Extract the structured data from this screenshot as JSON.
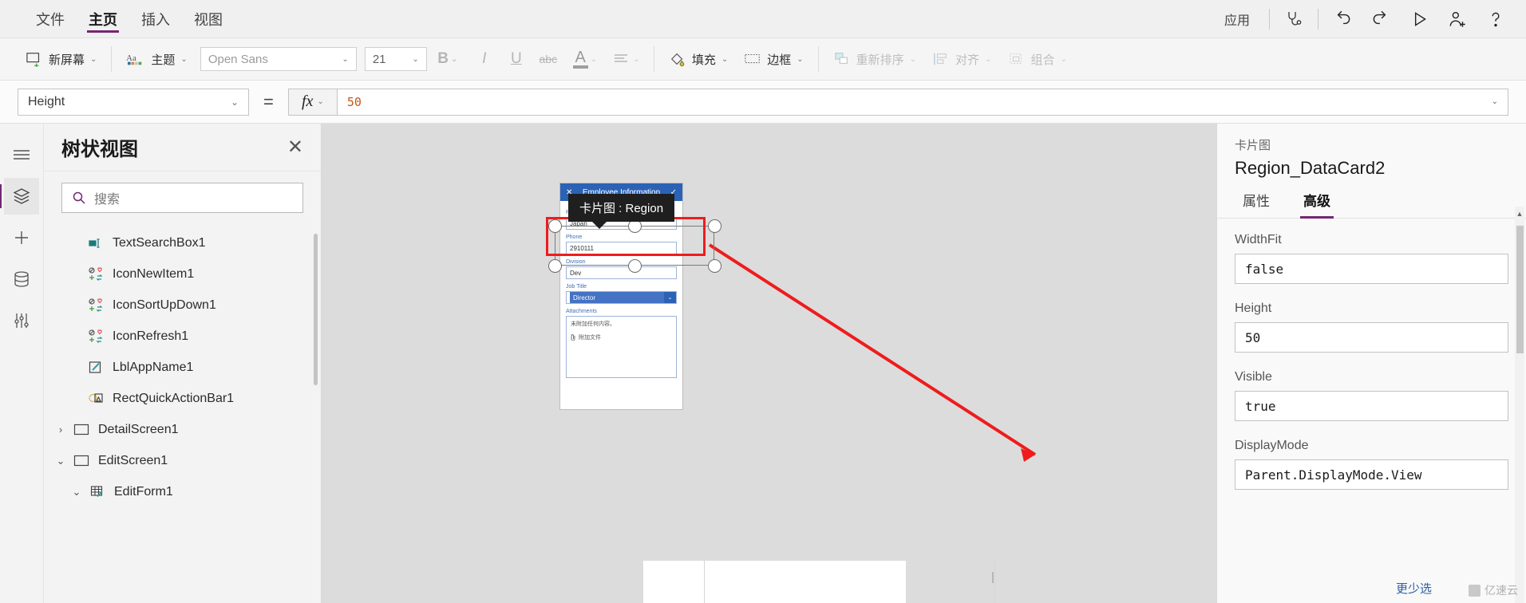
{
  "menubar": {
    "tabs": [
      {
        "label": "文件",
        "active": false
      },
      {
        "label": "主页",
        "active": true
      },
      {
        "label": "插入",
        "active": false
      },
      {
        "label": "视图",
        "active": false
      }
    ],
    "app_label": "应用",
    "icons": {
      "health": "stethoscope-icon",
      "undo": "undo-icon",
      "redo": "redo-icon",
      "preview": "play-icon",
      "share": "add-user-icon",
      "help": "help-icon"
    }
  },
  "ribbon": {
    "new_screen": "新屏幕",
    "theme": "主题",
    "font_name": "Open Sans",
    "font_size": "21",
    "bold": "B",
    "italic": "I",
    "underline": "U",
    "strikethrough": "abc",
    "font_color": "A",
    "align": "align-icon",
    "fill": "填充",
    "border": "边框",
    "reorder": "重新排序",
    "align_label": "对齐",
    "group_label": "组合"
  },
  "formula_bar": {
    "property": "Height",
    "equals": "=",
    "fx": "fx",
    "value": "50"
  },
  "tree_panel": {
    "title": "树状视图",
    "close": "✕",
    "search_placeholder": "搜索",
    "items": [
      {
        "label": "TextSearchBox1",
        "icon": "textbox-icon",
        "indent": 1,
        "chevron": ""
      },
      {
        "label": "IconNewItem1",
        "icon": "icon-set-icon",
        "indent": 1,
        "chevron": ""
      },
      {
        "label": "IconSortUpDown1",
        "icon": "icon-set-icon",
        "indent": 1,
        "chevron": ""
      },
      {
        "label": "IconRefresh1",
        "icon": "icon-set-icon",
        "indent": 1,
        "chevron": ""
      },
      {
        "label": "LblAppName1",
        "icon": "label-icon",
        "indent": 1,
        "chevron": ""
      },
      {
        "label": "RectQuickActionBar1",
        "icon": "shape-icon",
        "indent": 1,
        "chevron": ""
      },
      {
        "label": "DetailScreen1",
        "icon": "screen-icon",
        "indent": 0,
        "chevron": "›"
      },
      {
        "label": "EditScreen1",
        "icon": "screen-icon",
        "indent": 0,
        "chevron": "⌄"
      },
      {
        "label": "EditForm1",
        "icon": "form-icon",
        "indent": 2,
        "chevron": "⌄"
      }
    ]
  },
  "canvas": {
    "tooltip": "卡片图 : Region",
    "form": {
      "header_title": "Employee Information",
      "header_close": "✕",
      "header_check": "✓",
      "fields": [
        {
          "label": "Region",
          "value": "Japan",
          "type": "text"
        },
        {
          "label": "Phone",
          "value": "2910111",
          "type": "text"
        },
        {
          "label": "Division",
          "value": "Dev",
          "type": "text"
        },
        {
          "label": "Job Title",
          "value": "Director",
          "type": "dropdown"
        },
        {
          "label": "Attachments",
          "value": "",
          "type": "attachment"
        }
      ],
      "attachment_empty": "未附加任何内容。",
      "attachment_add": "附加文件"
    }
  },
  "properties_panel": {
    "kind": "卡片图",
    "name": "Region_DataCard2",
    "tabs": [
      {
        "label": "属性",
        "active": false
      },
      {
        "label": "高级",
        "active": true
      }
    ],
    "properties": [
      {
        "label": "WidthFit",
        "value": "false"
      },
      {
        "label": "Height",
        "value": "50"
      },
      {
        "label": "Visible",
        "value": "true"
      },
      {
        "label": "DisplayMode",
        "value": "Parent.DisplayMode.View"
      }
    ],
    "more_label": "更少选",
    "watermark": "亿速云"
  },
  "colors": {
    "accent": "#742774",
    "formula_value": "#c05a17",
    "highlight_red": "#ef1c1c",
    "form_header_blue": "#2c62b5",
    "tooltip_bg": "#1f1f1f"
  }
}
